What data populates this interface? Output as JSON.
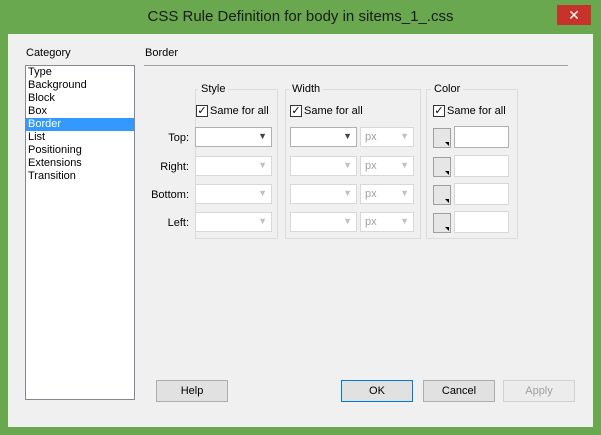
{
  "title": "CSS Rule Definition for body in sitems_1_.css",
  "close_glyph": "✕",
  "category": {
    "label": "Category",
    "items": [
      "Type",
      "Background",
      "Block",
      "Box",
      "Border",
      "List",
      "Positioning",
      "Extensions",
      "Transition"
    ],
    "selected": "Border"
  },
  "section_title": "Border",
  "groups": {
    "style": {
      "label": "Style",
      "same_for_all": "Same for all"
    },
    "width": {
      "label": "Width",
      "same_for_all": "Same for all"
    },
    "color": {
      "label": "Color",
      "same_for_all": "Same for all"
    }
  },
  "rows": [
    {
      "label": "Top:",
      "unit": "px"
    },
    {
      "label": "Right:",
      "unit": "px"
    },
    {
      "label": "Bottom:",
      "unit": "px"
    },
    {
      "label": "Left:",
      "unit": "px"
    }
  ],
  "buttons": {
    "help": "Help",
    "ok": "OK",
    "cancel": "Cancel",
    "apply": "Apply"
  },
  "colors": {
    "titlebar": "#69a84f",
    "close": "#c7332a",
    "selection": "#3399ff"
  }
}
